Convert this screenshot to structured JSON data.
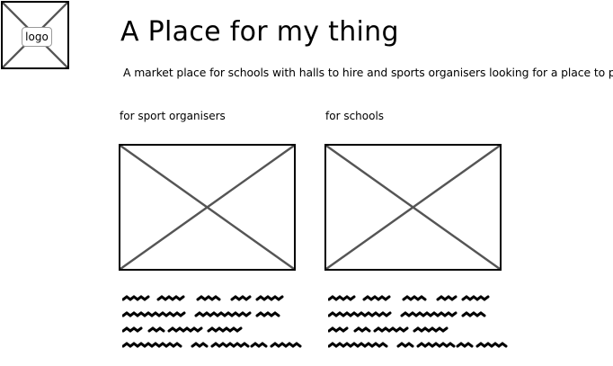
{
  "logo": {
    "label": "logo"
  },
  "header": {
    "title": "A Place for my thing",
    "tagline": "A market place for schools with halls to hire and sports organisers looking for a place to play"
  },
  "sections": [
    {
      "heading": "for sport organisers"
    },
    {
      "heading": "for schools"
    }
  ],
  "colors": {
    "stroke": "#000000",
    "cross": "#555555",
    "scribble": "#000000"
  }
}
